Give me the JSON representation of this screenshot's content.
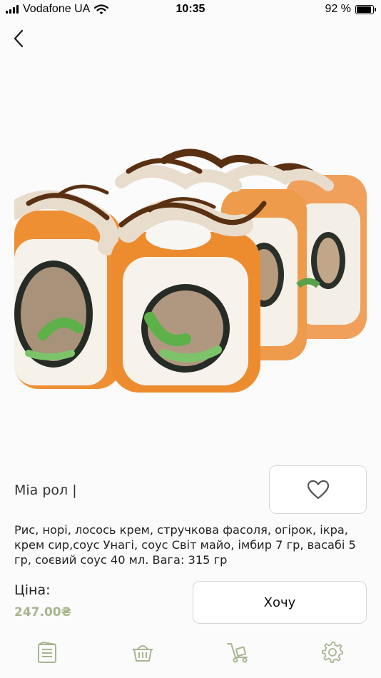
{
  "status_bar": {
    "carrier": "Vodafone UA",
    "time": "10:35",
    "battery_text": "92 %",
    "battery_level": 0.92,
    "icons": [
      "signal-icon",
      "wifi-icon",
      "battery-icon"
    ]
  },
  "nav": {
    "back_icon": "chevron-left-icon"
  },
  "product": {
    "name": "Міа рол |",
    "description": "Рис, норі, лосось крем, стручкова фасоля, огірок, ікра, крем сир,соус Унагі, соус Світ майо, імбир 7 гр, васабі 5 гр, соєвий соус 40 мл. Вага: 315 гр",
    "price_label": "Ціна:",
    "price": "247.00₴",
    "image": "sushi-roll-photo"
  },
  "actions": {
    "favorite_icon": "heart-icon",
    "want_label": "Хочу"
  },
  "tab_bar": {
    "items": [
      {
        "icon": "menu-list-icon"
      },
      {
        "icon": "basket-icon"
      },
      {
        "icon": "delivery-cart-icon"
      },
      {
        "icon": "settings-gear-icon"
      }
    ]
  },
  "colors": {
    "accent_price": "#a8b58e",
    "tab_icon": "#a8b58e",
    "border": "#d6d6d6",
    "background": "#fbfbfc"
  }
}
